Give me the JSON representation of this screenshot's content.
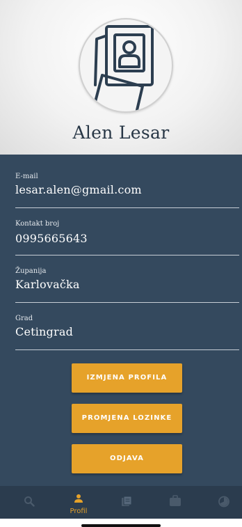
{
  "profile": {
    "name": "Alen Lesar"
  },
  "fields": [
    {
      "label": "E-mail",
      "value": "lesar.alen@gmail.com"
    },
    {
      "label": "Kontakt broj",
      "value": "0995665643"
    },
    {
      "label": "Županija",
      "value": "Karlovačka"
    },
    {
      "label": "Grad",
      "value": "Cetingrad"
    }
  ],
  "buttons": {
    "edit_profile": "IZMJENA PROFILA",
    "change_password": "PROMJENA LOZINKE",
    "logout": "ODJAVA"
  },
  "tabbar": {
    "active": "Profil",
    "tabs": [
      {
        "icon": "search-icon"
      },
      {
        "icon": "person-icon",
        "label": "Profil"
      },
      {
        "icon": "documents-icon"
      },
      {
        "icon": "briefcase-icon"
      },
      {
        "icon": "clock-icon"
      }
    ]
  },
  "colors": {
    "panel": "#34495e",
    "accent": "#e6a22a",
    "tabbar": "#2b3c4e"
  }
}
